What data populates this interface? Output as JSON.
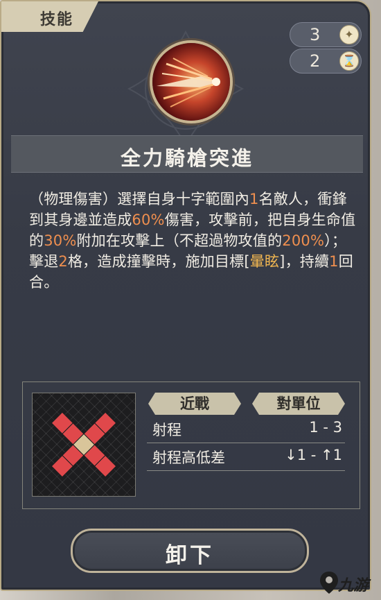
{
  "tab": {
    "label": "技能"
  },
  "resources": [
    {
      "value": "3",
      "icon": "star-icon"
    },
    {
      "value": "2",
      "icon": "hourglass-icon"
    }
  ],
  "skill": {
    "name": "全力騎槍突進",
    "desc": [
      {
        "t": "（物理傷害）選擇自身十字範圍內"
      },
      {
        "t": "1",
        "hl": "num"
      },
      {
        "t": "名敵人，衝鋒到其身邊並造成"
      },
      {
        "t": "60%",
        "hl": "num"
      },
      {
        "t": "傷害，攻擊前，把自身生命值的"
      },
      {
        "t": "30%",
        "hl": "num"
      },
      {
        "t": "附加在攻擊上（不超過物攻值的"
      },
      {
        "t": "200%",
        "hl": "num"
      },
      {
        "t": "）；擊退"
      },
      {
        "t": "2",
        "hl": "num"
      },
      {
        "t": "格，造成撞擊時，施加目標["
      },
      {
        "t": "暈眩",
        "hl": "status"
      },
      {
        "t": "]，持續"
      },
      {
        "t": "1",
        "hl": "num"
      },
      {
        "t": "回合。"
      }
    ]
  },
  "range": {
    "tags": [
      "近戰",
      "對單位"
    ],
    "rows": [
      {
        "label": "射程",
        "value": "1 - 3"
      },
      {
        "label": "射程高低差",
        "value": "↓1 - ↑1"
      }
    ]
  },
  "button": {
    "label": "卸下"
  },
  "watermark": {
    "text": "九游"
  },
  "colors": {
    "highlight": "#ef8f4f",
    "status": "#f0b651",
    "range_mark": "#e0484b"
  }
}
